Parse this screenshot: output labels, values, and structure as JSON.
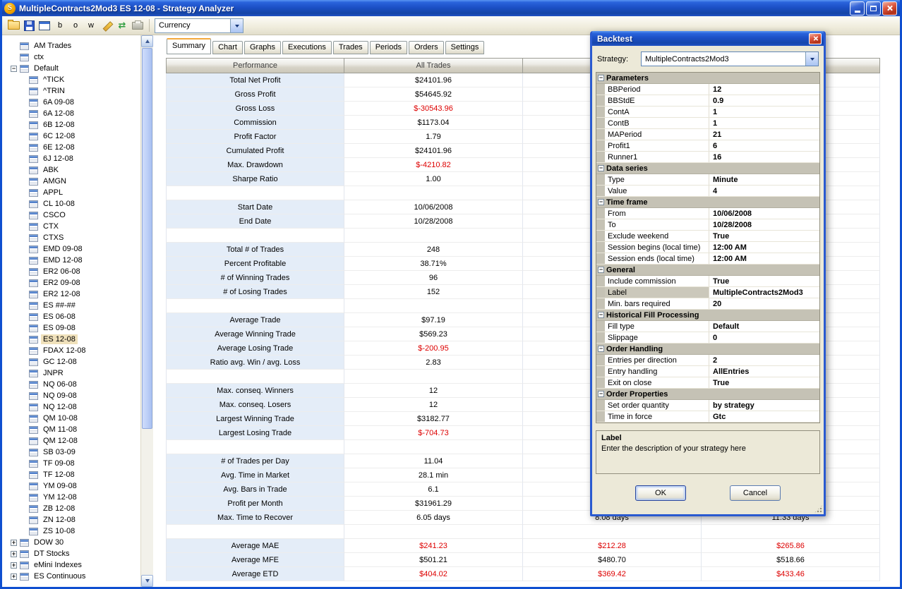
{
  "colors": {
    "titlebar_blue": "#1c50c6",
    "negative": "#dd0000",
    "selection": "#f0e1bb",
    "category_gray": "#c5c2b5"
  },
  "window": {
    "title": "MultipleContracts2Mod3  ES 12-08 - Strategy Analyzer",
    "icon_glyph": "S"
  },
  "toolbar": {
    "buttons": [
      {
        "name": "open",
        "label": ""
      },
      {
        "name": "save",
        "label": ""
      },
      {
        "name": "window",
        "label": ""
      },
      {
        "name": "letter-b",
        "label": "b"
      },
      {
        "name": "letter-o",
        "label": "o"
      },
      {
        "name": "letter-w",
        "label": "w"
      },
      {
        "name": "edit",
        "label": ""
      },
      {
        "name": "refresh",
        "label": ""
      },
      {
        "name": "print",
        "label": ""
      }
    ],
    "currency": {
      "value": "Currency"
    }
  },
  "tree": {
    "selected": "ES 12-08",
    "items": [
      {
        "label": "AM Trades",
        "level": 0,
        "expander": "none"
      },
      {
        "label": "ctx",
        "level": 0,
        "expander": "none"
      },
      {
        "label": "Default",
        "level": 0,
        "expander": "minus"
      },
      {
        "label": "^TICK",
        "level": 1
      },
      {
        "label": "^TRIN",
        "level": 1
      },
      {
        "label": "6A 09-08",
        "level": 1
      },
      {
        "label": "6A 12-08",
        "level": 1
      },
      {
        "label": "6B 12-08",
        "level": 1
      },
      {
        "label": "6C 12-08",
        "level": 1
      },
      {
        "label": "6E 12-08",
        "level": 1
      },
      {
        "label": "6J 12-08",
        "level": 1
      },
      {
        "label": "ABK",
        "level": 1
      },
      {
        "label": "AMGN",
        "level": 1
      },
      {
        "label": "APPL",
        "level": 1
      },
      {
        "label": "CL 10-08",
        "level": 1
      },
      {
        "label": "CSCO",
        "level": 1
      },
      {
        "label": "CTX",
        "level": 1
      },
      {
        "label": "CTXS",
        "level": 1
      },
      {
        "label": "EMD 09-08",
        "level": 1
      },
      {
        "label": "EMD 12-08",
        "level": 1
      },
      {
        "label": "ER2 06-08",
        "level": 1
      },
      {
        "label": "ER2 09-08",
        "level": 1
      },
      {
        "label": "ER2 12-08",
        "level": 1
      },
      {
        "label": "ES ##-##",
        "level": 1
      },
      {
        "label": "ES 06-08",
        "level": 1
      },
      {
        "label": "ES 09-08",
        "level": 1
      },
      {
        "label": "ES 12-08",
        "level": 1
      },
      {
        "label": "FDAX 12-08",
        "level": 1
      },
      {
        "label": "GC 12-08",
        "level": 1
      },
      {
        "label": "JNPR",
        "level": 1
      },
      {
        "label": "NQ 06-08",
        "level": 1
      },
      {
        "label": "NQ 09-08",
        "level": 1
      },
      {
        "label": "NQ 12-08",
        "level": 1
      },
      {
        "label": "QM 10-08",
        "level": 1
      },
      {
        "label": "QM 11-08",
        "level": 1
      },
      {
        "label": "QM 12-08",
        "level": 1
      },
      {
        "label": "SB 03-09",
        "level": 1
      },
      {
        "label": "TF 09-08",
        "level": 1
      },
      {
        "label": "TF 12-08",
        "level": 1
      },
      {
        "label": "YM 09-08",
        "level": 1
      },
      {
        "label": "YM 12-08",
        "level": 1
      },
      {
        "label": "ZB 12-08",
        "level": 1
      },
      {
        "label": "ZN 12-08",
        "level": 1
      },
      {
        "label": "ZS 10-08",
        "level": 1
      },
      {
        "label": "DOW 30",
        "level": 0,
        "expander": "plus"
      },
      {
        "label": "DT Stocks",
        "level": 0,
        "expander": "plus"
      },
      {
        "label": "eMini Indexes",
        "level": 0,
        "expander": "plus"
      },
      {
        "label": "ES Continuous",
        "level": 0,
        "expander": "plus"
      }
    ]
  },
  "tabs": {
    "active": "Summary",
    "items": [
      "Summary",
      "Chart",
      "Graphs",
      "Executions",
      "Trades",
      "Periods",
      "Orders",
      "Settings"
    ]
  },
  "table": {
    "columns": [
      "Performance",
      "All Trades",
      "",
      ""
    ],
    "rows": [
      {
        "label": "Total Net Profit",
        "values": [
          "$24101.96",
          "",
          ""
        ]
      },
      {
        "label": "Gross Profit",
        "values": [
          "$54645.92",
          "",
          ""
        ]
      },
      {
        "label": "Gross Loss",
        "values": [
          "$-30543.96",
          "",
          ""
        ],
        "red": [
          true,
          false,
          false
        ]
      },
      {
        "label": "Commission",
        "values": [
          "$1173.04",
          "",
          ""
        ]
      },
      {
        "label": "Profit Factor",
        "values": [
          "1.79",
          "",
          ""
        ]
      },
      {
        "label": "Cumulated Profit",
        "values": [
          "$24101.96",
          "",
          ""
        ]
      },
      {
        "label": "Max. Drawdown",
        "values": [
          "$-4210.82",
          "",
          ""
        ],
        "red": [
          true,
          false,
          false
        ]
      },
      {
        "label": "Sharpe Ratio",
        "values": [
          "1.00",
          "",
          ""
        ]
      },
      {
        "label": "",
        "values": [
          "",
          "",
          ""
        ]
      },
      {
        "label": "Start Date",
        "values": [
          "10/06/2008",
          "",
          ""
        ]
      },
      {
        "label": "End Date",
        "values": [
          "10/28/2008",
          "",
          ""
        ]
      },
      {
        "label": "",
        "values": [
          "",
          "",
          ""
        ]
      },
      {
        "label": "Total # of Trades",
        "values": [
          "248",
          "",
          ""
        ]
      },
      {
        "label": "Percent Profitable",
        "values": [
          "38.71%",
          "",
          ""
        ]
      },
      {
        "label": "# of Winning Trades",
        "values": [
          "96",
          "",
          ""
        ]
      },
      {
        "label": "# of Losing Trades",
        "values": [
          "152",
          "",
          ""
        ]
      },
      {
        "label": "",
        "values": [
          "",
          "",
          ""
        ]
      },
      {
        "label": "Average Trade",
        "values": [
          "$97.19",
          "",
          ""
        ]
      },
      {
        "label": "Average Winning Trade",
        "values": [
          "$569.23",
          "",
          ""
        ]
      },
      {
        "label": "Average Losing Trade",
        "values": [
          "$-200.95",
          "",
          ""
        ],
        "red": [
          true,
          false,
          false
        ]
      },
      {
        "label": "Ratio avg. Win / avg. Loss",
        "values": [
          "2.83",
          "",
          ""
        ]
      },
      {
        "label": "",
        "values": [
          "",
          "",
          ""
        ]
      },
      {
        "label": "Max. conseq. Winners",
        "values": [
          "12",
          "",
          ""
        ]
      },
      {
        "label": "Max. conseq. Losers",
        "values": [
          "12",
          "",
          ""
        ]
      },
      {
        "label": "Largest Winning Trade",
        "values": [
          "$3182.77",
          "",
          ""
        ]
      },
      {
        "label": "Largest Losing Trade",
        "values": [
          "$-704.73",
          "",
          ""
        ],
        "red": [
          true,
          false,
          false
        ]
      },
      {
        "label": "",
        "values": [
          "",
          "",
          ""
        ]
      },
      {
        "label": "# of Trades per Day",
        "values": [
          "11.04",
          "",
          ""
        ]
      },
      {
        "label": "Avg. Time in Market",
        "values": [
          "28.1 min",
          "",
          ""
        ]
      },
      {
        "label": "Avg. Bars in Trade",
        "values": [
          "6.1",
          "",
          ""
        ]
      },
      {
        "label": "Profit per Month",
        "values": [
          "$31961.29",
          "",
          ""
        ]
      },
      {
        "label": "Max. Time to Recover",
        "values": [
          "6.05 days",
          "8.08 days",
          "11.33 days"
        ]
      },
      {
        "label": "",
        "values": [
          "",
          "",
          ""
        ]
      },
      {
        "label": "Average MAE",
        "values": [
          "$241.23",
          "$212.28",
          "$265.86"
        ],
        "red": [
          true,
          true,
          true
        ]
      },
      {
        "label": "Average MFE",
        "values": [
          "$501.21",
          "$480.70",
          "$518.66"
        ]
      },
      {
        "label": "Average ETD",
        "values": [
          "$404.02",
          "$369.42",
          "$433.46"
        ],
        "red": [
          true,
          true,
          true
        ]
      }
    ]
  },
  "dialog": {
    "title": "Backtest",
    "strategy_label": "Strategy:",
    "strategy_value": "MultipleContracts2Mod3",
    "grid": [
      {
        "type": "category",
        "label": "Parameters"
      },
      {
        "type": "row",
        "name": "BBPeriod",
        "value": "12"
      },
      {
        "type": "row",
        "name": "BBStdE",
        "value": "0.9"
      },
      {
        "type": "row",
        "name": "ContA",
        "value": "1"
      },
      {
        "type": "row",
        "name": "ContB",
        "value": "1"
      },
      {
        "type": "row",
        "name": "MAPeriod",
        "value": "21"
      },
      {
        "type": "row",
        "name": "Profit1",
        "value": "6"
      },
      {
        "type": "row",
        "name": "Runner1",
        "value": "16"
      },
      {
        "type": "category",
        "label": "Data series"
      },
      {
        "type": "row",
        "name": "Type",
        "value": "Minute"
      },
      {
        "type": "row",
        "name": "Value",
        "value": "4"
      },
      {
        "type": "category",
        "label": "Time frame"
      },
      {
        "type": "row",
        "name": "From",
        "value": "10/06/2008"
      },
      {
        "type": "row",
        "name": "To",
        "value": "10/28/2008"
      },
      {
        "type": "row",
        "name": "Exclude weekend",
        "value": "True"
      },
      {
        "type": "row",
        "name": "Session begins (local time)",
        "value": "12:00 AM"
      },
      {
        "type": "row",
        "name": "Session ends (local time)",
        "value": "12:00 AM"
      },
      {
        "type": "category",
        "label": "General"
      },
      {
        "type": "row",
        "name": "Include commission",
        "value": "True"
      },
      {
        "type": "row",
        "name": "Label",
        "value": "MultipleContracts2Mod3",
        "selected": true
      },
      {
        "type": "row",
        "name": "Min. bars required",
        "value": "20"
      },
      {
        "type": "category",
        "label": "Historical Fill Processing"
      },
      {
        "type": "row",
        "name": "Fill type",
        "value": "Default"
      },
      {
        "type": "row",
        "name": "Slippage",
        "value": "0"
      },
      {
        "type": "category",
        "label": "Order Handling"
      },
      {
        "type": "row",
        "name": "Entries per direction",
        "value": "2"
      },
      {
        "type": "row",
        "name": "Entry handling",
        "value": "AllEntries"
      },
      {
        "type": "row",
        "name": "Exit on close",
        "value": "True"
      },
      {
        "type": "category",
        "label": "Order Properties"
      },
      {
        "type": "row",
        "name": "Set order quantity",
        "value": "by strategy"
      },
      {
        "type": "row",
        "name": "Time in force",
        "value": "Gtc"
      }
    ],
    "description": {
      "title": "Label",
      "text": "Enter the description of your strategy here"
    },
    "ok": "OK",
    "cancel": "Cancel"
  }
}
